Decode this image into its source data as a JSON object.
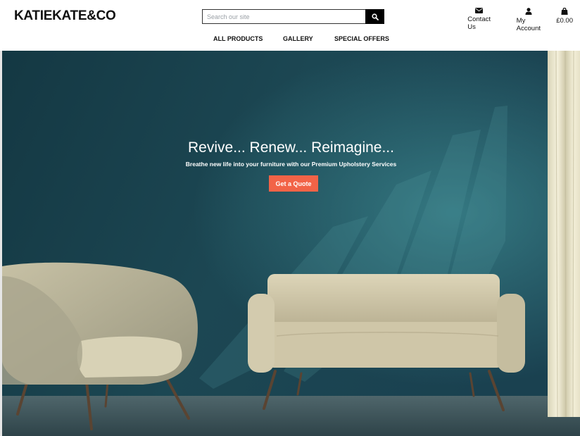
{
  "brand": {
    "logo_text": "KATIEKATE&CO"
  },
  "search": {
    "placeholder": "Search our site",
    "value": ""
  },
  "header_links": [
    {
      "label": "Contact Us",
      "icon": "envelope-icon"
    },
    {
      "label": "My Account",
      "icon": "user-icon"
    },
    {
      "label": "£0.00",
      "icon": "shopping-bag-icon"
    }
  ],
  "nav": {
    "items": [
      "ALL PRODUCTS",
      "GALLERY",
      "SPECIAL OFFERS"
    ]
  },
  "hero": {
    "title": "Revive... Renew... Reimagine...",
    "subtitle": "Breathe new life into your furniture with our Premium Upholstery Services",
    "cta_label": "Get a Quote"
  },
  "colors": {
    "accent": "#f26347",
    "wall": "#1d4a57",
    "header_bg": "#ffffff",
    "text": "#111111"
  }
}
